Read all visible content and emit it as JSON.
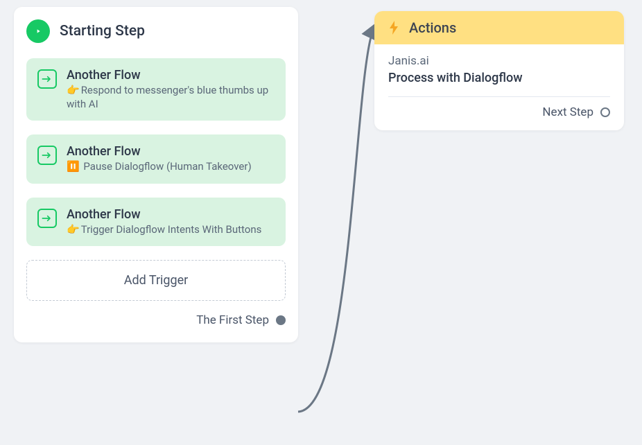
{
  "starting": {
    "title": "Starting Step",
    "flows": [
      {
        "title": "Another Flow",
        "emoji": "👉",
        "sub": "Respond to messenger's blue thumbs up with AI"
      },
      {
        "title": "Another Flow",
        "emoji": "⏸️",
        "sub": " Pause Dialogflow (Human Takeover)"
      },
      {
        "title": "Another Flow",
        "emoji": "👉",
        "sub": "Trigger Dialogflow Intents With Buttons"
      }
    ],
    "add_trigger_label": "Add Trigger",
    "first_step_label": "The First Step"
  },
  "actions": {
    "header": "Actions",
    "provider": "Janis.ai",
    "description": "Process with Dialogflow",
    "next_step_label": "Next Step"
  }
}
